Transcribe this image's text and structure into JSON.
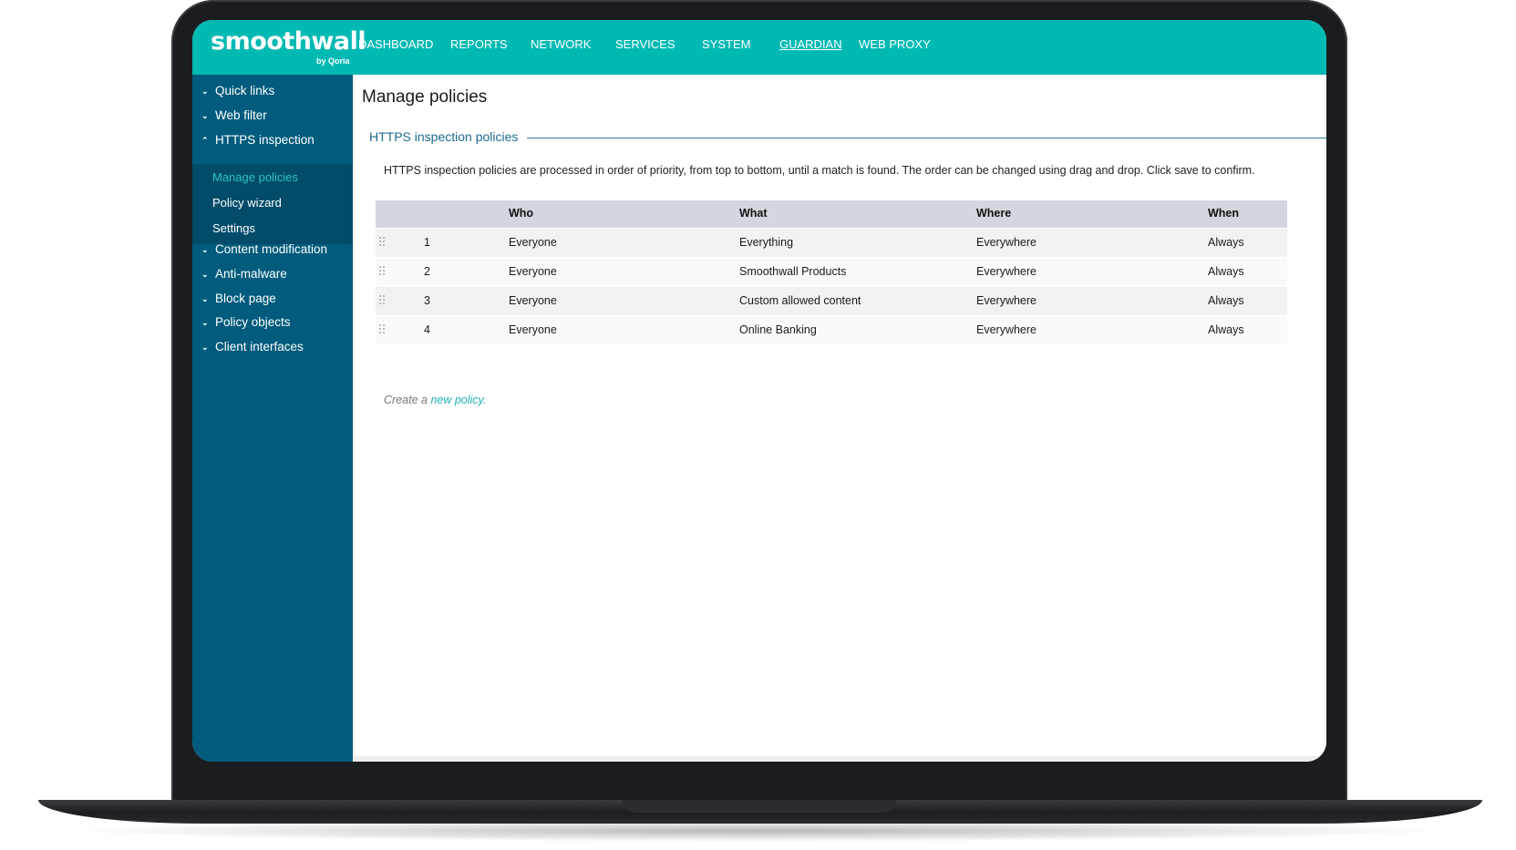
{
  "brand": {
    "logo_text": "smoothwall",
    "logo_sub": "by Qoria",
    "accent_color": "#00b9b3",
    "sidebar_color": "#005b7c"
  },
  "nav": {
    "items": [
      {
        "label": "DASHBOARD"
      },
      {
        "label": "REPORTS"
      },
      {
        "label": "NETWORK"
      },
      {
        "label": "SERVICES"
      },
      {
        "label": "SYSTEM"
      },
      {
        "label": "GUARDIAN",
        "active": true
      },
      {
        "label": "WEB PROXY"
      }
    ]
  },
  "sidebar": {
    "items": [
      {
        "label": "Quick links",
        "icon": "chevron-down-icon"
      },
      {
        "label": "Web filter",
        "icon": "chevron-down-icon"
      },
      {
        "label": "HTTPS inspection",
        "icon": "chevron-up-icon",
        "expanded": true
      },
      {
        "label": "Content modification",
        "icon": "chevron-down-icon"
      },
      {
        "label": "Anti-malware",
        "icon": "chevron-down-icon"
      },
      {
        "label": "Block page",
        "icon": "chevron-down-icon"
      },
      {
        "label": "Policy objects",
        "icon": "chevron-down-icon"
      },
      {
        "label": "Client interfaces",
        "icon": "chevron-down-icon"
      }
    ],
    "submenu": [
      {
        "label": "Manage policies",
        "active": true
      },
      {
        "label": "Policy wizard"
      },
      {
        "label": "Settings"
      }
    ]
  },
  "main": {
    "page_title": "Manage policies",
    "section_title": "HTTPS inspection policies",
    "description": "HTTPS inspection policies are processed in order of priority, from top to bottom, until a match is found. The order can be changed using drag and drop. Click save to confirm.",
    "table": {
      "columns": [
        "Who",
        "What",
        "Where",
        "When"
      ],
      "rows": [
        {
          "num": "1",
          "who": "Everyone",
          "what": "Everything",
          "where": "Everywhere",
          "when": "Always"
        },
        {
          "num": "2",
          "who": "Everyone",
          "what": "Smoothwall Products",
          "where": "Everywhere",
          "when": "Always"
        },
        {
          "num": "3",
          "who": "Everyone",
          "what": "Custom allowed content",
          "where": "Everywhere",
          "when": "Always"
        },
        {
          "num": "4",
          "who": "Everyone",
          "what": "Online Banking",
          "where": "Everywhere",
          "when": "Always"
        }
      ]
    },
    "create_prefix": "Create a",
    "create_link": "new policy."
  }
}
